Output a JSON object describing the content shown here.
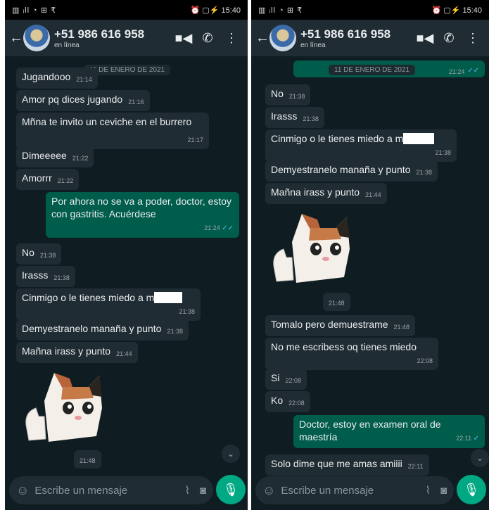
{
  "status": {
    "signal": "▥ ᵢll ◔ ⊞ ₹",
    "right": "⏰ ▢⚡ 15:40"
  },
  "header": {
    "phone": "+51 986 616 958",
    "status": "en línea",
    "back": "←",
    "video": "■◀",
    "call": "✆",
    "more": "⋮"
  },
  "compose": {
    "placeholder": "Escribe un mensaje",
    "emoji": "☺",
    "attach": "⌇",
    "camera": "◙",
    "mic": "🎙"
  },
  "left": {
    "date": "11 DE ENERO DE 2021",
    "messages": [
      {
        "text": "Jugandooo",
        "time": "21:14"
      },
      {
        "text": "Amor pq dices jugando",
        "time": "21:16"
      },
      {
        "text": "Mñna te invito un ceviche en el burrero",
        "time": "21:17"
      },
      {
        "text": "Dimeeeee",
        "time": "21:22"
      },
      {
        "text": "Amorrr",
        "time": "21:22"
      },
      {
        "text": "Por ahora no se va a poder, doctor, estoy con gastritis. Acuérdese",
        "time": "21:24",
        "ticks": "✓✓"
      },
      {
        "text": "No",
        "time": "21:38"
      },
      {
        "text": "Irasss",
        "time": "21:38"
      },
      {
        "text": "Cinmigo o le tienes miedo  a m",
        "time": "21:38"
      },
      {
        "text": "Demyestranelo manaña y punto",
        "time": "21:38"
      },
      {
        "text": "Mañna irass y punto",
        "time": "21:44"
      }
    ],
    "sticker_time": "21:48"
  },
  "right": {
    "date": "11 DE ENERO DE 2021",
    "top_time": "21:24",
    "top_ticks": "✓✓",
    "messages": [
      {
        "text": "No",
        "time": "21:38"
      },
      {
        "text": "Irasss",
        "time": "21:38"
      },
      {
        "text": "Cinmigo o le tienes miedo  a m",
        "time": "21:38"
      },
      {
        "text": "Demyestranelo manaña y punto",
        "time": "21:38"
      },
      {
        "text": "Mañna irass y punto",
        "time": "21:44"
      },
      {
        "text": "Tomalo pero demuestrame",
        "time": "21:48"
      },
      {
        "text": "No me escribess oq tienes miedo",
        "time": "22:08"
      },
      {
        "text": "Si",
        "time": "22:08"
      },
      {
        "text": "Ko",
        "time": "22:08"
      },
      {
        "text": "Doctor, estoy en examen oral de maestría",
        "time": "22:11",
        "ticks": "✓"
      },
      {
        "text": "Solo dime que me amas amiiii",
        "time": "22:11"
      }
    ],
    "sticker_time": "21:48"
  },
  "colors": {
    "chat_bg": "#0f1c22",
    "incoming": "#202c33",
    "outgoing": "#005c4b",
    "accent": "#00a884"
  }
}
